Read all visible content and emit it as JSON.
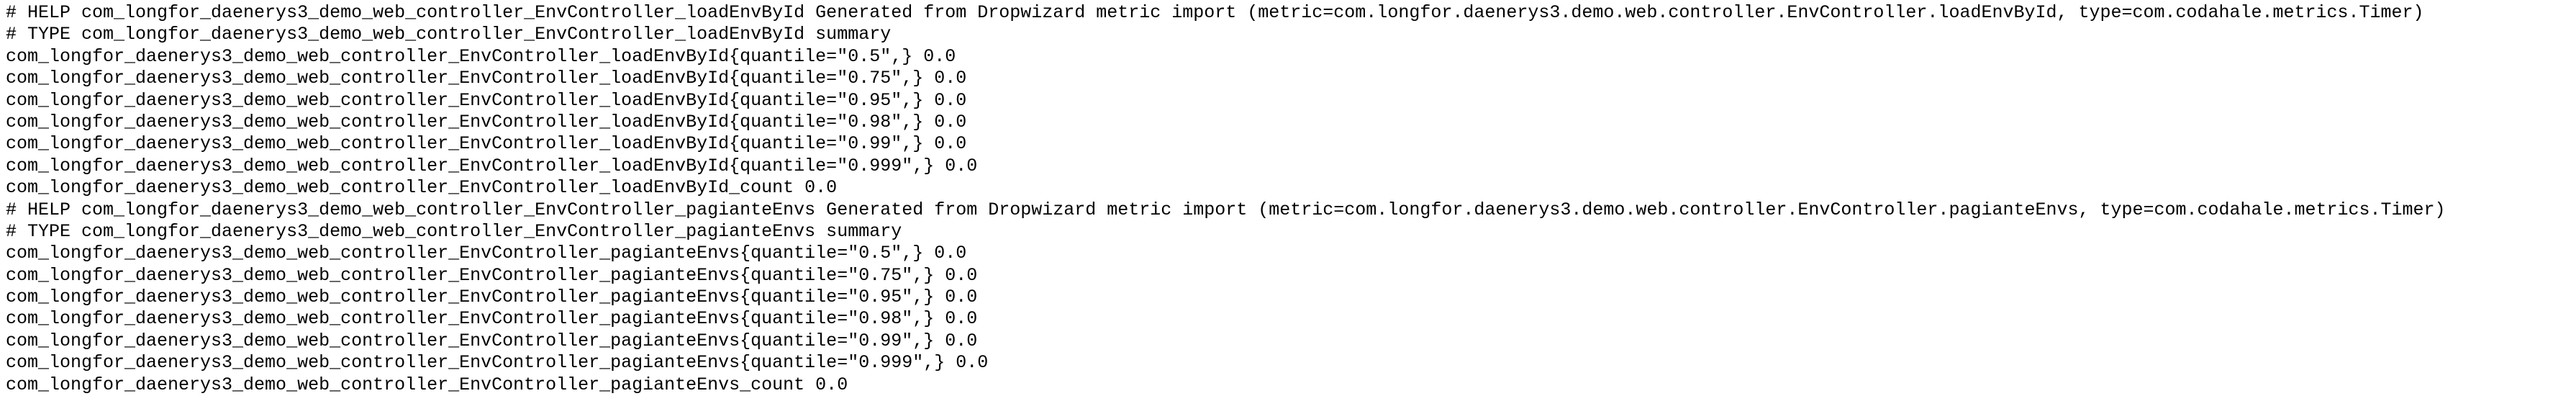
{
  "lines": [
    "# HELP com_longfor_daenerys3_demo_web_controller_EnvController_loadEnvById Generated from Dropwizard metric import (metric=com.longfor.daenerys3.demo.web.controller.EnvController.loadEnvById, type=com.codahale.metrics.Timer)",
    "# TYPE com_longfor_daenerys3_demo_web_controller_EnvController_loadEnvById summary",
    "com_longfor_daenerys3_demo_web_controller_EnvController_loadEnvById{quantile=\"0.5\",} 0.0",
    "com_longfor_daenerys3_demo_web_controller_EnvController_loadEnvById{quantile=\"0.75\",} 0.0",
    "com_longfor_daenerys3_demo_web_controller_EnvController_loadEnvById{quantile=\"0.95\",} 0.0",
    "com_longfor_daenerys3_demo_web_controller_EnvController_loadEnvById{quantile=\"0.98\",} 0.0",
    "com_longfor_daenerys3_demo_web_controller_EnvController_loadEnvById{quantile=\"0.99\",} 0.0",
    "com_longfor_daenerys3_demo_web_controller_EnvController_loadEnvById{quantile=\"0.999\",} 0.0",
    "com_longfor_daenerys3_demo_web_controller_EnvController_loadEnvById_count 0.0",
    "# HELP com_longfor_daenerys3_demo_web_controller_EnvController_pagianteEnvs Generated from Dropwizard metric import (metric=com.longfor.daenerys3.demo.web.controller.EnvController.pagianteEnvs, type=com.codahale.metrics.Timer)",
    "# TYPE com_longfor_daenerys3_demo_web_controller_EnvController_pagianteEnvs summary",
    "com_longfor_daenerys3_demo_web_controller_EnvController_pagianteEnvs{quantile=\"0.5\",} 0.0",
    "com_longfor_daenerys3_demo_web_controller_EnvController_pagianteEnvs{quantile=\"0.75\",} 0.0",
    "com_longfor_daenerys3_demo_web_controller_EnvController_pagianteEnvs{quantile=\"0.95\",} 0.0",
    "com_longfor_daenerys3_demo_web_controller_EnvController_pagianteEnvs{quantile=\"0.98\",} 0.0",
    "com_longfor_daenerys3_demo_web_controller_EnvController_pagianteEnvs{quantile=\"0.99\",} 0.0",
    "com_longfor_daenerys3_demo_web_controller_EnvController_pagianteEnvs{quantile=\"0.999\",} 0.0",
    "com_longfor_daenerys3_demo_web_controller_EnvController_pagianteEnvs_count 0.0"
  ]
}
